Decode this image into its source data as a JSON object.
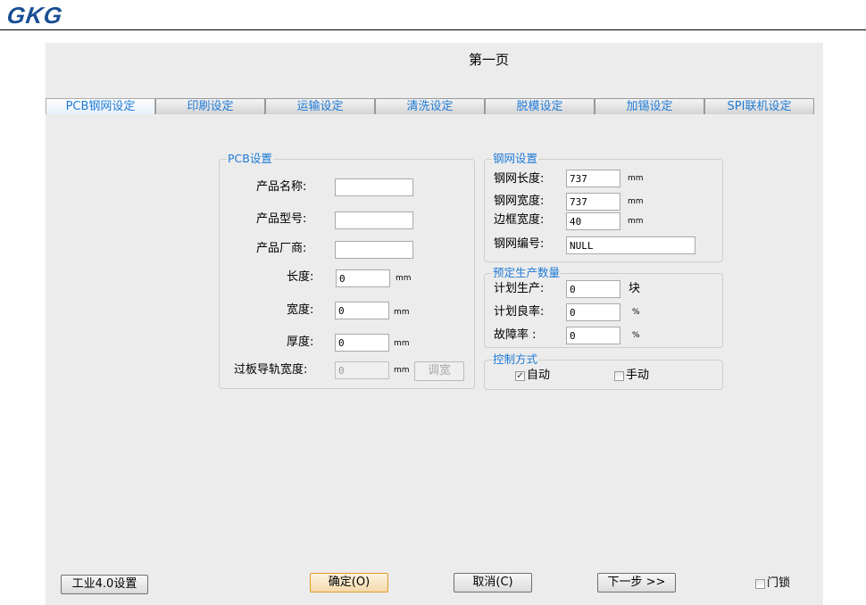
{
  "logo": "GKG",
  "title": "第一页",
  "tabs": [
    "PCB钢网设定",
    "印刷设定",
    "运输设定",
    "清洗设定",
    "脱模设定",
    "加锡设定",
    "SPI联机设定"
  ],
  "pcb": {
    "legend": "PCB设置",
    "name_label": "产品名称:",
    "name": "",
    "model_label": "产品型号:",
    "model": "",
    "vendor_label": "产品厂商:",
    "vendor": "",
    "length_label": "长度:",
    "length": "0",
    "width_label": "宽度:",
    "width": "0",
    "thickness_label": "厚度:",
    "thickness": "0",
    "rail_label": "过板导轨宽度:",
    "rail": "0",
    "unit": "mm",
    "adjust": "调宽"
  },
  "stencil": {
    "legend": "钢网设置",
    "length_label": "钢网长度:",
    "length": "737",
    "width_label": "钢网宽度:",
    "width": "737",
    "frame_label": "边框宽度:",
    "frame": "40",
    "id_label": "钢网编号:",
    "id": "NULL",
    "unit": "mm"
  },
  "production": {
    "legend": "预定生产数量",
    "plan_label": "计划生产:",
    "plan": "0",
    "plan_unit": "块",
    "yield_label": "计划良率:",
    "yield": "0",
    "fail_label": "故障率 :",
    "fail": "0",
    "pct": "%"
  },
  "control": {
    "legend": "控制方式",
    "auto": "自动",
    "auto_checked": true,
    "manual": "手动",
    "manual_checked": false
  },
  "buttons": {
    "industry": "工业4.0设置",
    "ok": "确定(O)",
    "cancel": "取消(C)",
    "next": "下一步 >>",
    "lock": "门锁"
  }
}
